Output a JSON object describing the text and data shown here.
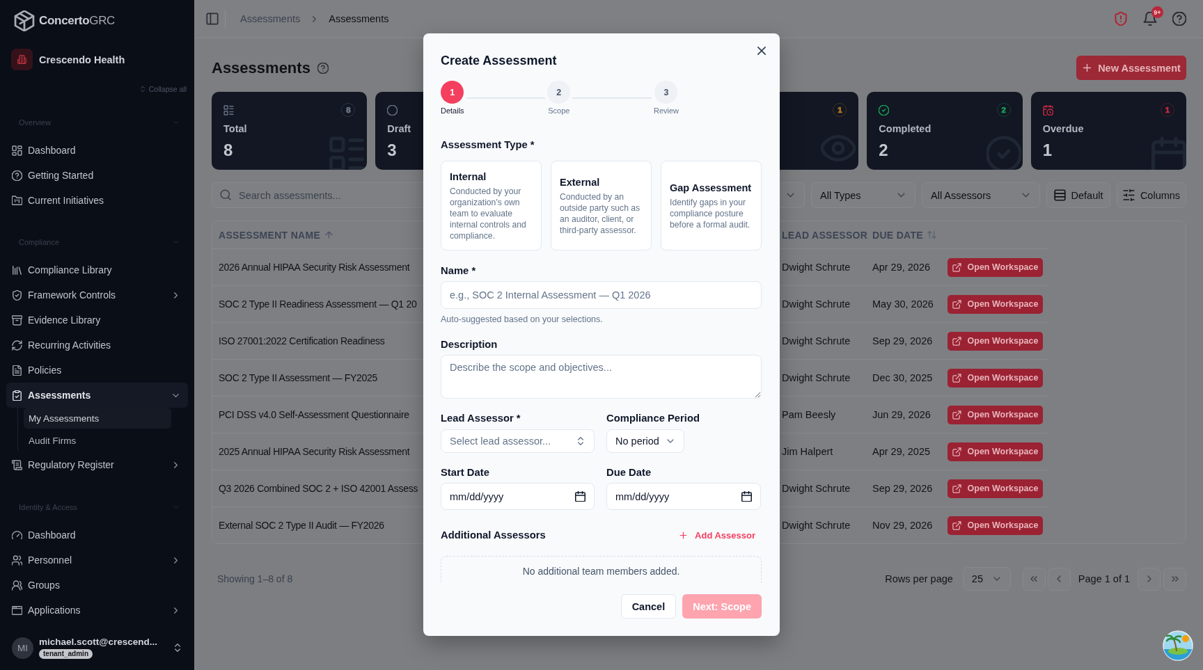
{
  "sidebar": {
    "brand": "**Concerto**GRC",
    "organization": "Crescendo Health",
    "collapse_label": "Collapse all",
    "sections": [
      {
        "title": "Overview",
        "expanded": true,
        "items": [
          {
            "label": "Dashboard",
            "kind": "link",
            "selected": false
          },
          {
            "label": "Getting Started",
            "kind": "link",
            "selected": false
          },
          {
            "label": "Current Initiatives",
            "kind": "link",
            "selected": false
          }
        ]
      },
      {
        "title": "Compliance",
        "expanded": true,
        "items": [
          {
            "label": "Compliance Library",
            "kind": "link",
            "selected": false
          },
          {
            "label": "Framework Controls",
            "kind": "group",
            "selected": false,
            "expanded": false
          },
          {
            "label": "Evidence Library",
            "kind": "link",
            "selected": false
          },
          {
            "label": "Recurring Activities",
            "kind": "link",
            "selected": false
          },
          {
            "label": "Policies",
            "kind": "link",
            "selected": false
          },
          {
            "label": "Assessments",
            "kind": "group",
            "selected": true,
            "expanded": true,
            "children": [
              {
                "label": "My Assessments",
                "selected": true
              },
              {
                "label": "Audit Firms",
                "selected": false
              }
            ]
          },
          {
            "label": "Regulatory Register",
            "kind": "group",
            "selected": false,
            "expanded": false
          }
        ]
      },
      {
        "title": "Identity & Access",
        "expanded": true,
        "items": [
          {
            "label": "Dashboard",
            "kind": "link",
            "selected": false
          },
          {
            "label": "Personnel",
            "kind": "group",
            "selected": false,
            "expanded": false
          },
          {
            "label": "Groups",
            "kind": "link",
            "selected": false
          },
          {
            "label": "Applications",
            "kind": "group",
            "selected": false,
            "expanded": false
          }
        ]
      }
    ],
    "user": {
      "initials": "MI",
      "email": "michael.scott@crescend...",
      "role": "tenant_admin"
    }
  },
  "topbar": {
    "breadcrumbs": [
      {
        "label": "Assessments",
        "current": false
      },
      {
        "label": "Assessments",
        "current": true
      }
    ],
    "notification_badge": "9+"
  },
  "page": {
    "title": "Assessments",
    "new_button": "New Assessment",
    "stat_cards": [
      {
        "label": "Total",
        "value": "8",
        "badge": "8",
        "color": "#6b7384"
      },
      {
        "label": "Draft",
        "value": "3",
        "color": "#6b7384"
      },
      {
        "badge": "1",
        "color": "#b7791f"
      },
      {
        "label": "Completed",
        "value": "2",
        "badge": "2",
        "color": "#17a155"
      },
      {
        "label": "Overdue",
        "value": "1",
        "badge": "1",
        "color": "#c8283f"
      }
    ],
    "search": {
      "placeholder": "Search assessments..."
    },
    "toolbar": [
      {
        "kind": "select"
      },
      {
        "kind": "select",
        "value": "All Types"
      },
      {
        "kind": "select",
        "value": "All Assessors"
      },
      {
        "kind": "button",
        "label": "Default"
      },
      {
        "kind": "button",
        "label": "Columns"
      }
    ],
    "table": {
      "columns": [
        {
          "label": "ASSESSMENT NAME",
          "sortable": true,
          "sorted": true
        },
        {
          "label": "LEAD ASSESSOR",
          "sortable": false,
          "sorted": false
        },
        {
          "label": "DUE DATE",
          "sortable": true,
          "sorted": false
        }
      ],
      "rows": [
        {
          "name": "2026 Annual HIPAA Security Risk Assessment",
          "lead_assessor": "Dwight Schrute",
          "due_date": "Apr 29, 2026",
          "action": "Open Workspace"
        },
        {
          "name": "SOC 2 Type II Readiness Assessment — Q1 20",
          "lead_assessor": "Dwight Schrute",
          "due_date": "May 30, 2026",
          "action": "Open Workspace"
        },
        {
          "name": "ISO 27001:2022 Certification Readiness",
          "lead_assessor": "Dwight Schrute",
          "due_date": "Sep 29, 2026",
          "action": "Open Workspace"
        },
        {
          "name": "SOC 2 Type II Assessment — FY2025",
          "lead_assessor": "Dwight Schrute",
          "due_date": "Dec 30, 2025",
          "action": "Open Workspace"
        },
        {
          "name": "PCI DSS v4.0 Self-Assessment Questionnaire",
          "lead_assessor": "Pam Beesly",
          "due_date": "Jun 29, 2026",
          "action": "Open Workspace"
        },
        {
          "name": "2025 Annual HIPAA Security Risk Assessment",
          "lead_assessor": "Jim Halpert",
          "due_date": "Apr 29, 2025",
          "action": "Open Workspace"
        },
        {
          "name": "Q3 2026 Combined SOC 2 + ISO 42001 Assess",
          "lead_assessor": "Dwight Schrute",
          "due_date": "Sep 29, 2026",
          "action": "Open Workspace"
        },
        {
          "name": "External SOC 2 Type II Audit — FY2026",
          "lead_assessor": "Dwight Schrute",
          "due_date": "Nov 29, 2026",
          "action": "Open Workspace"
        }
      ]
    },
    "footer": {
      "showing": "Showing 1–8 of 8",
      "rows_per_page_label": "Rows per page",
      "rows_per_page": "25",
      "page": "Page 1 of 1"
    }
  },
  "dialog": {
    "title": "Create Assessment",
    "steps": [
      {
        "number": "1",
        "label": "Details",
        "selected": true
      },
      {
        "number": "2",
        "label": "Scope",
        "selected": false
      },
      {
        "number": "3",
        "label": "Review",
        "selected": false
      }
    ],
    "type_label": "Assessment Type *",
    "types": [
      {
        "title": "Internal",
        "description": "Conducted by your organization's own team to evaluate internal controls and compliance.",
        "selected": false
      },
      {
        "title": "External",
        "description": "Conducted by an outside party such as an auditor, client, or third-party assessor.",
        "selected": false
      },
      {
        "title": "Gap Assessment",
        "description": "Identify gaps in your compliance posture before a formal audit.",
        "selected": false
      }
    ],
    "name": {
      "label": "Name *",
      "placeholder": "e.g., SOC 2 Internal Assessment — Q1 2026",
      "hint": "Auto-suggested based on your selections."
    },
    "description": {
      "label": "Description",
      "placeholder": "Describe the scope and objectives..."
    },
    "lead_assessor": {
      "label": "Lead Assessor *",
      "placeholder": "Select lead assessor..."
    },
    "compliance_period": {
      "label": "Compliance Period",
      "value": "No period"
    },
    "start_date": {
      "label": "Start Date",
      "placeholder": "mm/dd/yyyy"
    },
    "due_date": {
      "label": "Due Date",
      "placeholder": "mm/dd/yyyy"
    },
    "additional": {
      "title": "Additional Assessors",
      "add_label": "Add Assessor",
      "empty": "No additional team members added."
    },
    "buttons": [
      {
        "label": "Cancel",
        "kind": "secondary",
        "disabled": false
      },
      {
        "label": "Next: Scope",
        "kind": "primary",
        "disabled": true
      }
    ]
  }
}
